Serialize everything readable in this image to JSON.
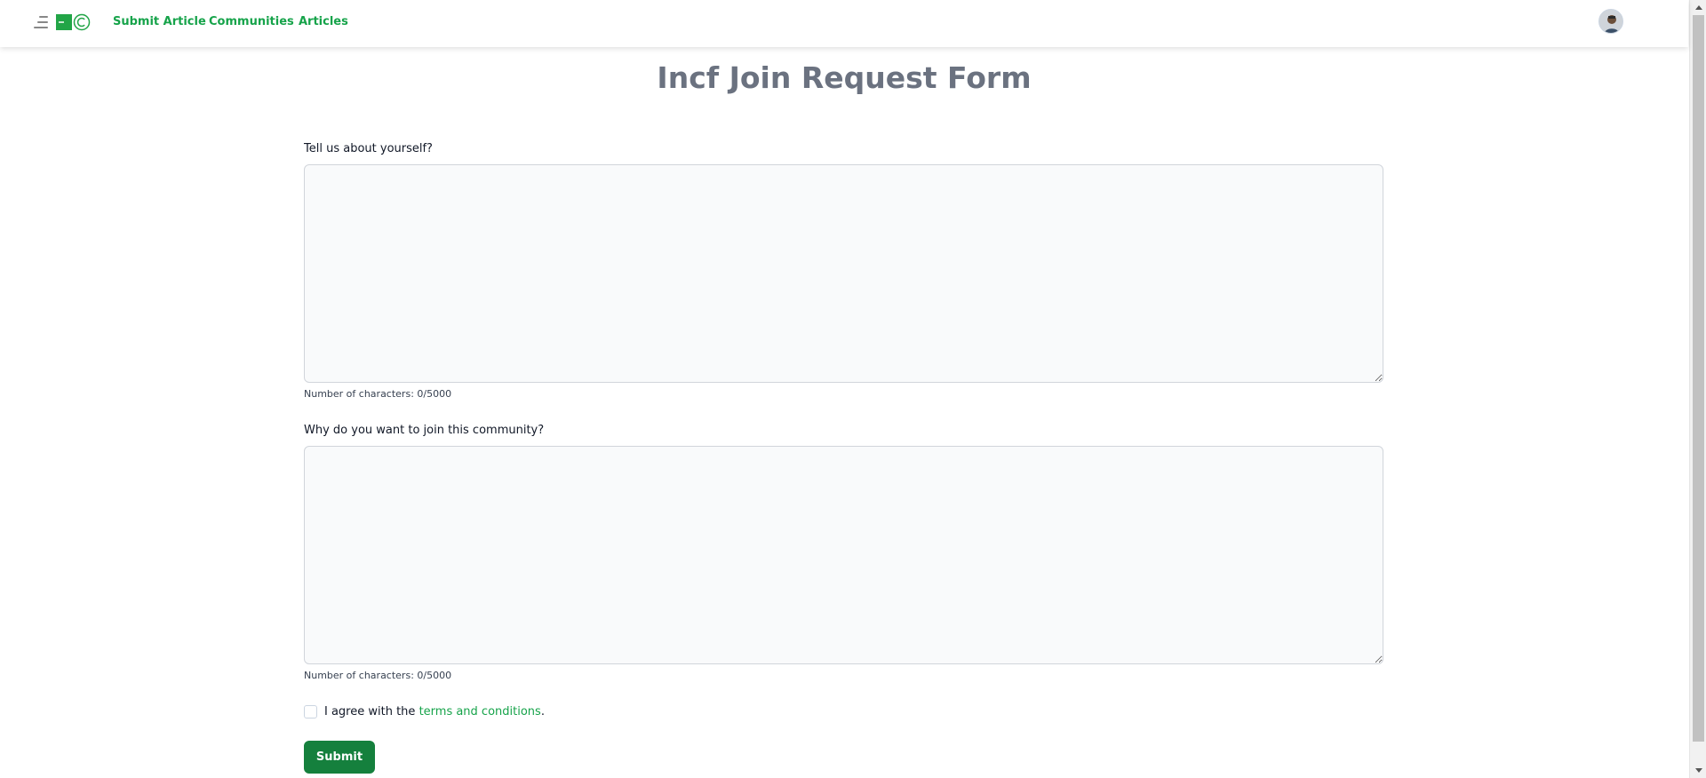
{
  "nav": {
    "links": [
      "Submit Article",
      "Communities",
      "Articles"
    ]
  },
  "icons": {
    "menu": "menu-icon",
    "logo": "site-logo",
    "avatar": "user-avatar",
    "scroll_up": "scroll-up-arrow-icon",
    "scroll_down": "scroll-down-arrow-icon"
  },
  "colors": {
    "brand": "#16a34a",
    "submit": "#15803d",
    "title": "#6b7280"
  },
  "main": {
    "title": "Incf Join Request Form",
    "fields": [
      {
        "label": "Tell us about yourself?",
        "value": "",
        "char_count": "Number of characters: 0/5000"
      },
      {
        "label": "Why do you want to join this community?",
        "value": "",
        "char_count": "Number of characters: 0/5000"
      }
    ],
    "terms": {
      "prefix": "I agree with the ",
      "link": "terms and conditions",
      "suffix": ".",
      "checked": false
    },
    "submit_label": "Submit"
  }
}
